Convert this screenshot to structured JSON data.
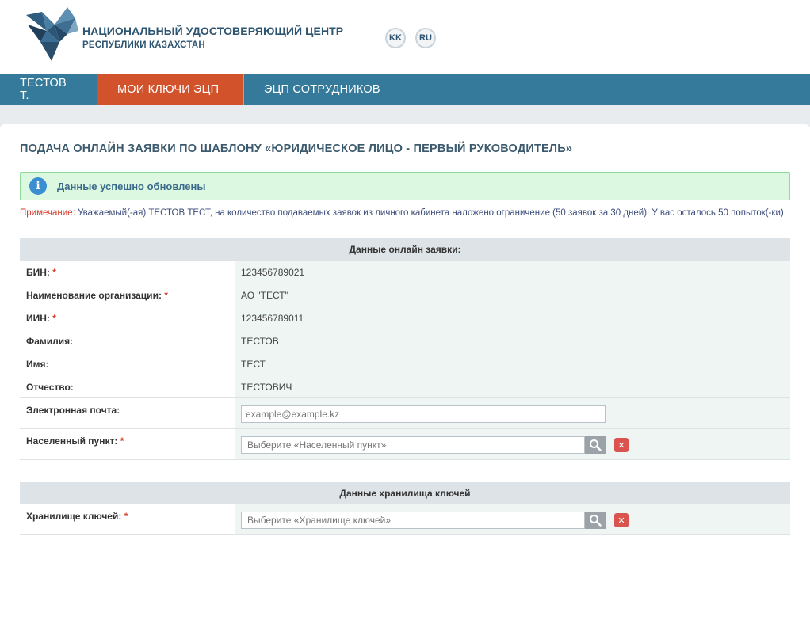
{
  "header": {
    "org_line1": "НАЦИОНАЛЬНЫЙ УДОСТОВЕРЯЮЩИЙ ЦЕНТР",
    "org_line2": "РЕСПУБЛИКИ КАЗАХСТАН",
    "lang_kk": "KK",
    "lang_ru": "RU"
  },
  "nav": {
    "user": "ТЕСТОВ Т.",
    "my_keys": "МОИ КЛЮЧИ ЭЦП",
    "employees": "ЭЦП СОТРУДНИКОВ"
  },
  "page": {
    "title": "ПОДАЧА ОНЛАЙН ЗАЯВКИ ПО ШАБЛОНУ «ЮРИДИЧЕСКОЕ ЛИЦО - ПЕРВЫЙ РУКОВОДИТЕЛЬ»",
    "alert": "Данные успешно обновлены",
    "note_label": "Примечание:",
    "note_text": " Уважаемый(-ая) ТЕСТОВ ТЕСТ, на количество подаваемых заявок из личного кабинета наложено ограничение (50 заявок за 30 дней). У вас осталось 50 попыток(-ки)."
  },
  "form1": {
    "header": "Данные онлайн заявки:",
    "bin_label": "БИН:",
    "bin_value": "123456789021",
    "org_label": "Наименование организации:",
    "org_value": "АО \"ТЕСТ\"",
    "iin_label": "ИИН:",
    "iin_value": "123456789011",
    "surname_label": "Фамилия:",
    "surname_value": "ТЕСТОВ",
    "name_label": "Имя:",
    "name_value": "ТЕСТ",
    "patronymic_label": "Отчество:",
    "patronymic_value": "ТЕСТОВИЧ",
    "email_label": "Электронная почта:",
    "email_placeholder": "example@example.kz",
    "locality_label": "Населенный пункт:",
    "locality_placeholder": "Выберите «Населенный пункт»"
  },
  "form2": {
    "header": "Данные хранилища ключей",
    "storage_label": "Хранилище ключей:",
    "storage_placeholder": "Выберите «Хранилище ключей»"
  },
  "required_mark": "*",
  "icons": {
    "logo": "nuc-logo",
    "info": "info-icon",
    "search": "search-icon",
    "clear": "close-icon"
  },
  "colors": {
    "nav_bg": "#357a9a",
    "nav_active": "#d2532b",
    "alert_bg": "#ddf8e1",
    "required": "#d63a2a"
  }
}
